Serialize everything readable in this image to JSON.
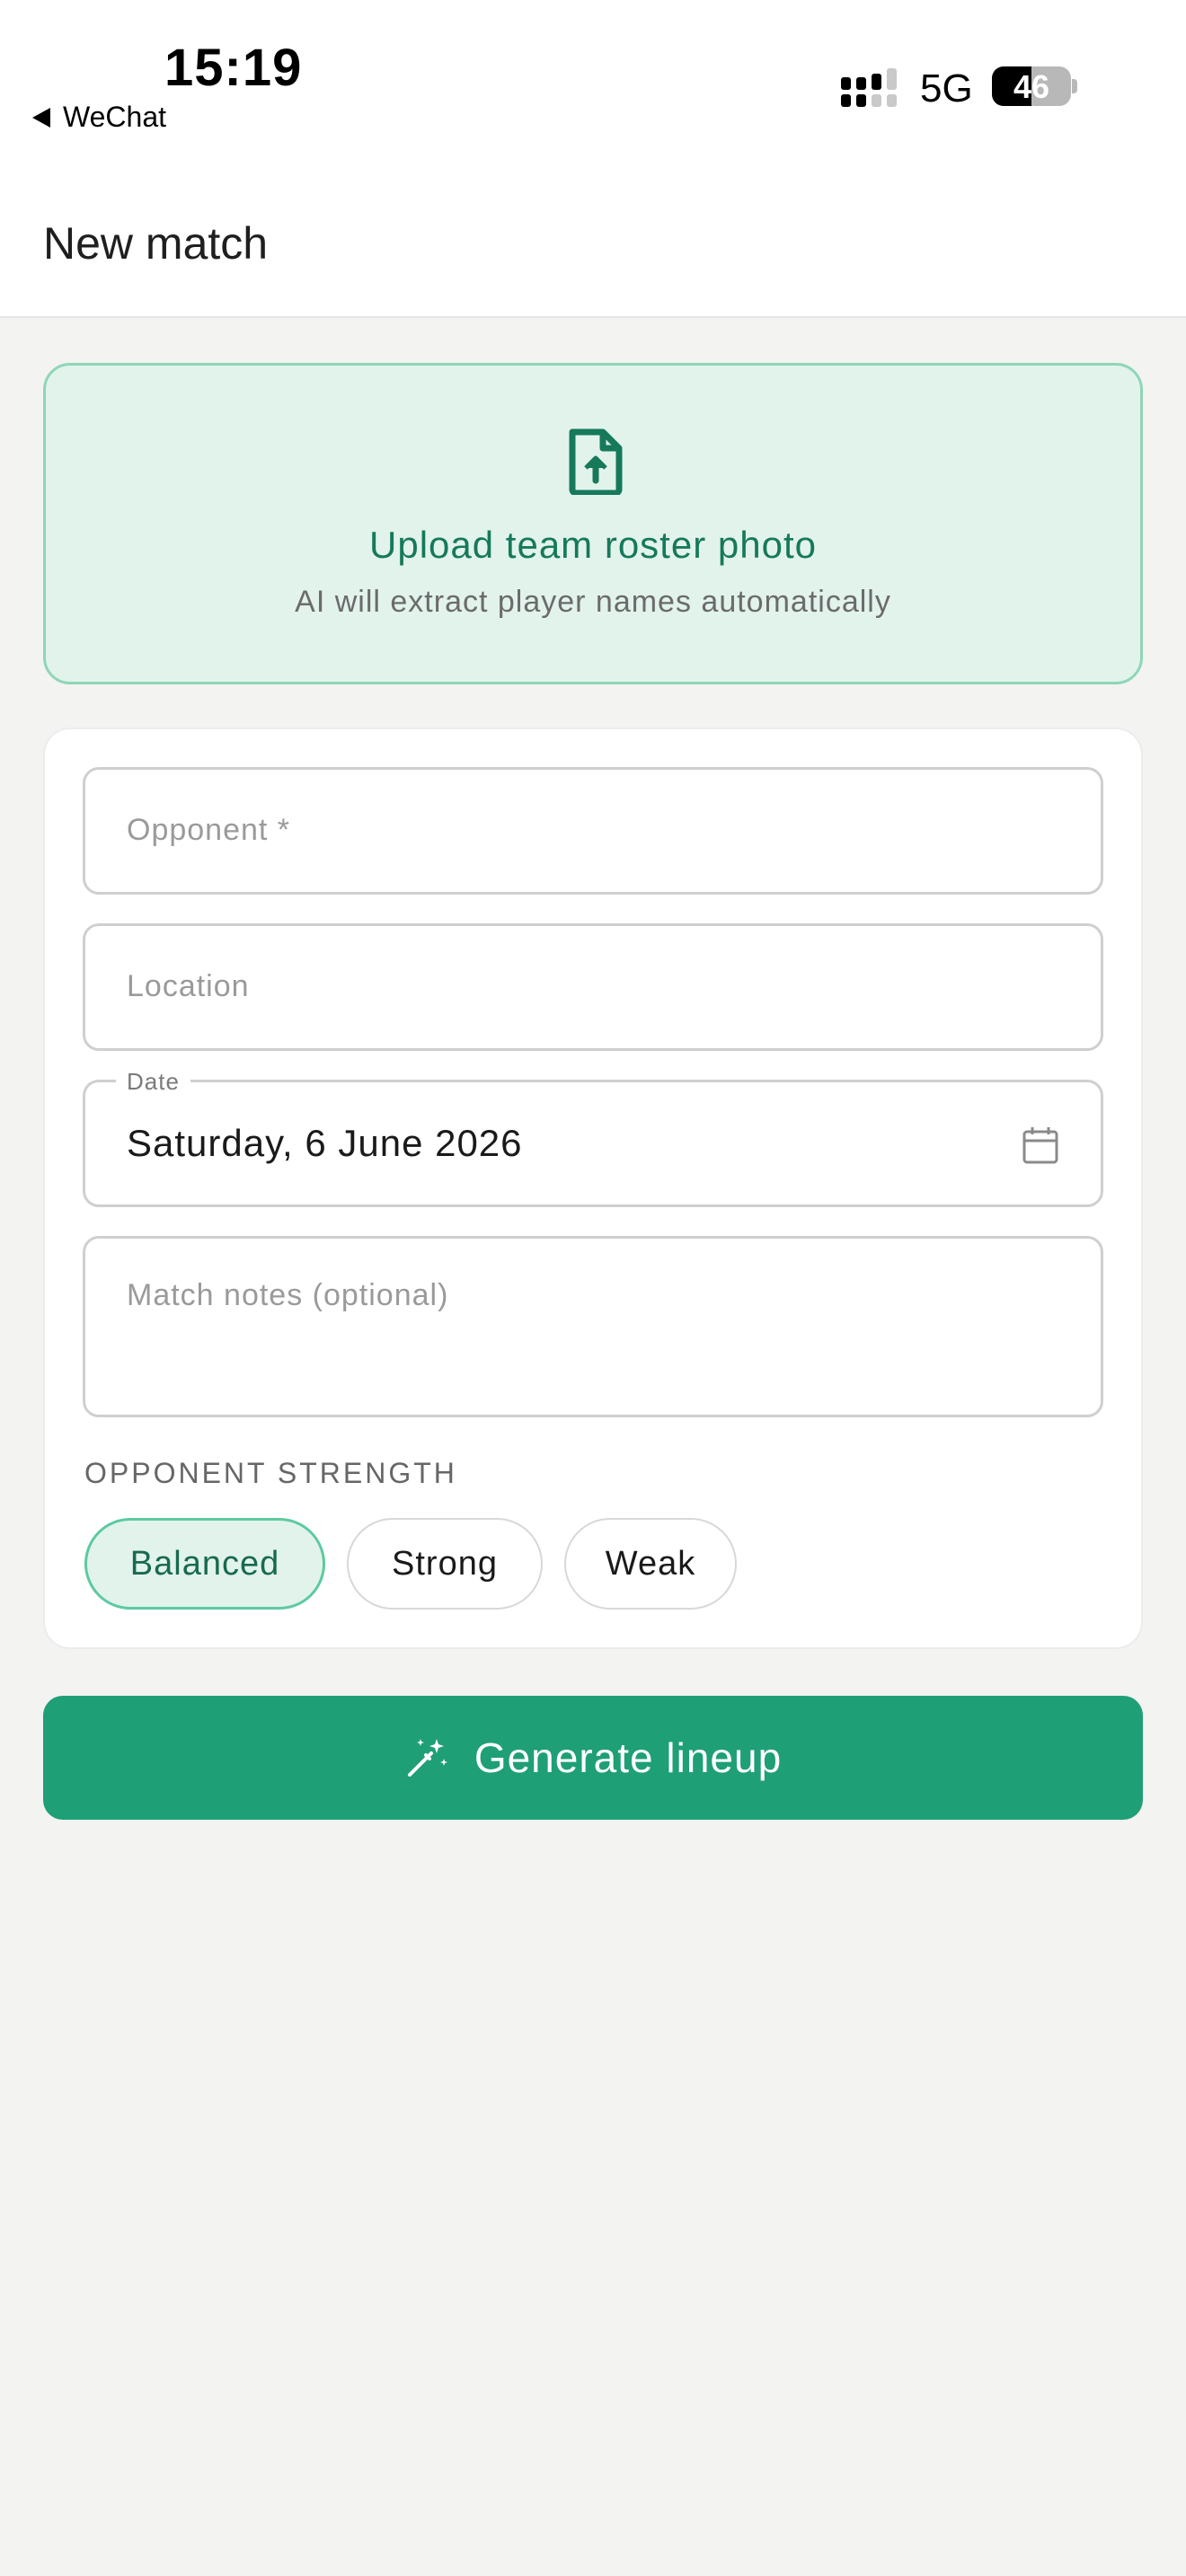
{
  "status_bar": {
    "time": "15:19",
    "back_app": "WeChat",
    "network": "5G",
    "battery": "46",
    "battery_level": 0.46
  },
  "header": {
    "title": "New match"
  },
  "upload": {
    "icon": "file-upload-icon",
    "title": "Upload team roster photo",
    "subtitle": "AI will extract player names automatically"
  },
  "form": {
    "opponent_placeholder": "Opponent *",
    "location_placeholder": "Location",
    "date_label": "Date",
    "date_value": "Saturday, 6 June 2026",
    "notes_placeholder": "Match notes (optional)",
    "strength_label": "OPPONENT STRENGTH",
    "strength_options": [
      "Balanced",
      "Strong",
      "Weak"
    ],
    "strength_selected": "Balanced"
  },
  "actions": {
    "generate_label": "Generate lineup",
    "generate_icon": "magic-wand-icon"
  },
  "colors": {
    "accent": "#1f9f76",
    "accent_text": "#15795a",
    "upload_bg": "#e2f3ec",
    "upload_border": "#8fd6b6",
    "background": "#f3f3f2"
  }
}
